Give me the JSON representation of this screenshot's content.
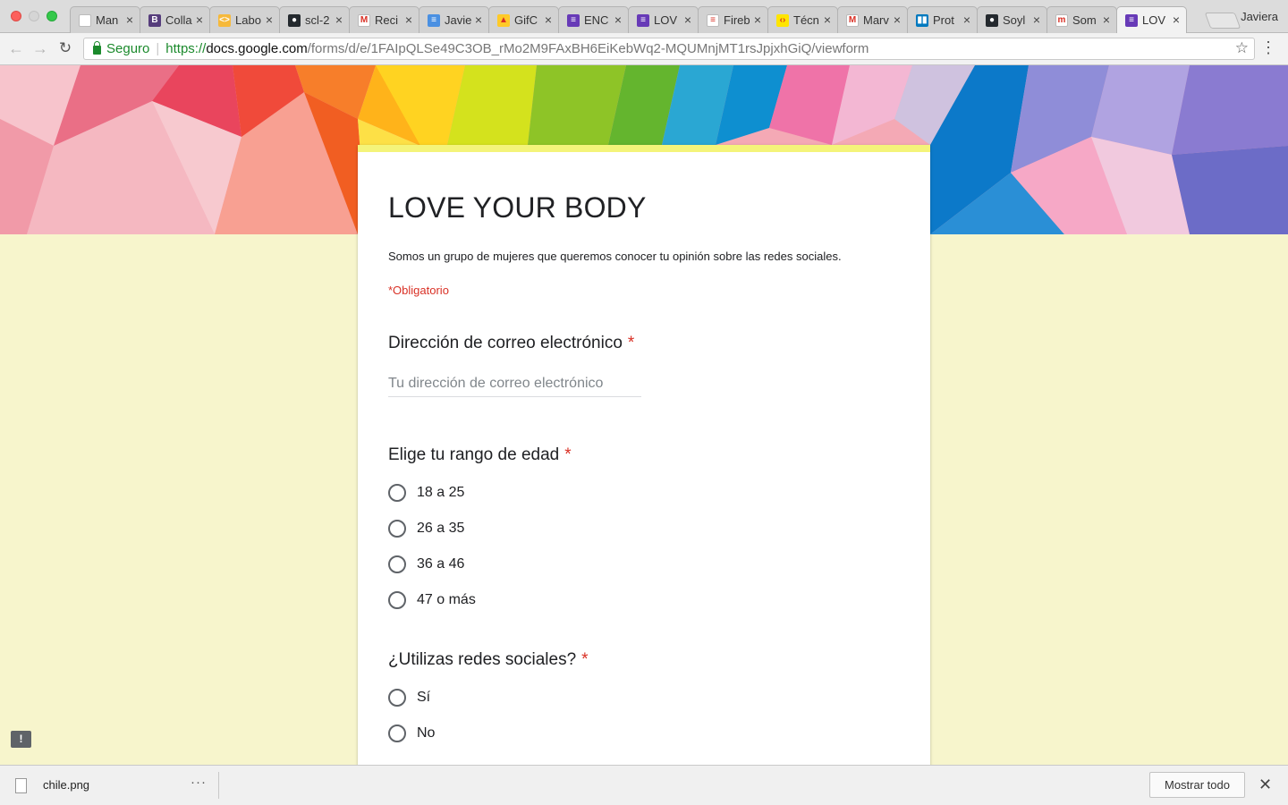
{
  "browser": {
    "profile_name": "Javiera",
    "tabs": [
      {
        "title": "Man",
        "icon": "document-icon",
        "color": "#ffffff",
        "glyph": ""
      },
      {
        "title": "Colla",
        "icon": "bootstrap-icon",
        "color": "#563d7c",
        "glyph": "B"
      },
      {
        "title": "Labo",
        "icon": "code-icon",
        "color": "#f6b93b",
        "glyph": "<>"
      },
      {
        "title": "scl-2",
        "icon": "github-icon",
        "color": "#24292e",
        "glyph": "●"
      },
      {
        "title": "Reci",
        "icon": "gmail-icon",
        "color": "#ffffff",
        "glyph": "M"
      },
      {
        "title": "Javie",
        "icon": "filter-icon",
        "color": "#4a90e2",
        "glyph": "≡"
      },
      {
        "title": "GifC",
        "icon": "firebase-icon",
        "color": "#ffca28",
        "glyph": "▲"
      },
      {
        "title": "ENC",
        "icon": "google-forms-icon",
        "color": "#673ab7",
        "glyph": "≡"
      },
      {
        "title": "LOV",
        "icon": "google-forms-icon",
        "color": "#673ab7",
        "glyph": "≡"
      },
      {
        "title": "Fireb",
        "icon": "stack-icon",
        "color": "#ffffff",
        "glyph": "≡"
      },
      {
        "title": "Técn",
        "icon": "code-icon",
        "color": "#ffe500",
        "glyph": "‹›"
      },
      {
        "title": "Marv",
        "icon": "marvel-icon",
        "color": "#ffffff",
        "glyph": "M"
      },
      {
        "title": "Prot",
        "icon": "trello-icon",
        "color": "#0079bf",
        "glyph": "▮▮"
      },
      {
        "title": "Soyl",
        "icon": "github-icon",
        "color": "#24292e",
        "glyph": "●"
      },
      {
        "title": "Som",
        "icon": "m-logo-icon",
        "color": "#ffffff",
        "glyph": "m"
      },
      {
        "title": "LOV",
        "icon": "google-forms-icon",
        "color": "#673ab7",
        "glyph": "≡"
      }
    ],
    "active_tab_index": 15,
    "security_label": "Seguro",
    "url_scheme": "https://",
    "url_domain": "docs.google.com",
    "url_path": "/forms/d/e/1FAIpQLSe49C3OB_rMo2M9FAxBH6EiKebWq2-MQUMnjMT1rsJpjxhGiQ/viewform"
  },
  "form": {
    "title": "LOVE YOUR BODY",
    "description": "Somos un grupo de mujeres que queremos conocer tu opinión sobre las redes sociales.",
    "required_note": "*Obligatorio",
    "accent_color": "#f4f47a",
    "required_color": "#d93025",
    "questions": [
      {
        "title": "Dirección de correo electrónico",
        "required_mark": "*",
        "type": "text",
        "placeholder": "Tu dirección de correo electrónico",
        "value": ""
      },
      {
        "title": "Elige tu rango de edad",
        "required_mark": "*",
        "type": "radio",
        "options": [
          "18 a 25",
          "26 a 35",
          "36 a 46",
          "47 o más"
        ]
      },
      {
        "title": "¿Utilizas redes sociales?",
        "required_mark": "*",
        "type": "radio",
        "options": [
          "Sí",
          "No"
        ]
      }
    ]
  },
  "feedback_icon": "!",
  "download_shelf": {
    "file_name": "chile.png",
    "more_label": "···",
    "show_all_label": "Mostrar todo",
    "close_label": "✕"
  }
}
